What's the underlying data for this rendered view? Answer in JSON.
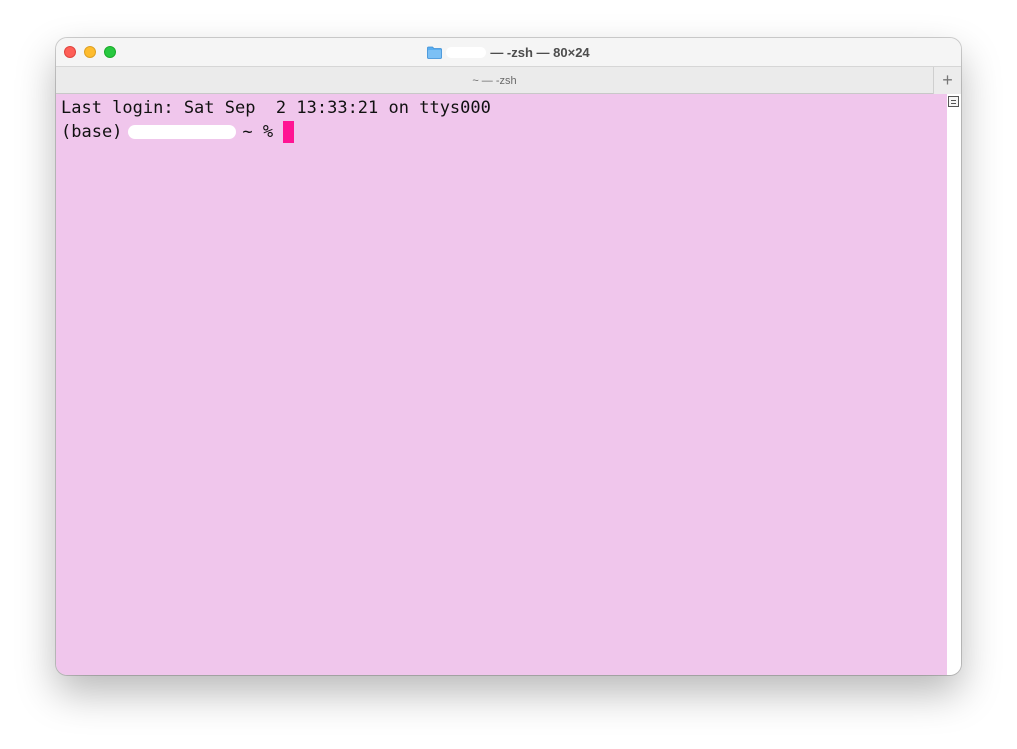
{
  "window": {
    "title_suffix": "— -zsh — 80×24",
    "tab_title": "~ — -zsh",
    "new_tab_label": "+"
  },
  "terminal": {
    "last_login_line": "Last login: Sat Sep  2 13:33:21 on ttys000",
    "prompt_prefix": "(base)",
    "prompt_suffix": "~ %"
  },
  "colors": {
    "terminal_background": "#f0c6ec",
    "cursor": "#ff1493",
    "close_button": "#fe5f57",
    "minimize_button": "#febc2e",
    "maximize_button": "#28c840"
  }
}
